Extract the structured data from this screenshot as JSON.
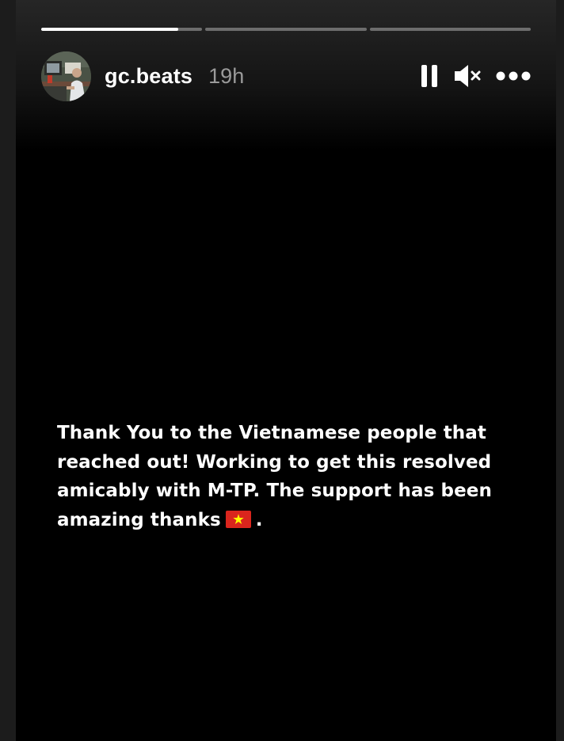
{
  "story": {
    "username": "gc.beats",
    "timestamp": "19h",
    "progress": {
      "segments": [
        {
          "fill": 0.85
        },
        {
          "fill": 0
        },
        {
          "fill": 0
        }
      ]
    },
    "controls": {
      "pause_icon": "pause-icon",
      "mute_icon": "muted-speaker-icon",
      "more_icon": "more-dots-icon"
    },
    "caption": {
      "text": "Thank You to the Vietnamese people that reached out! Working to get this resolved amicably with M-TP. The support has been amazing thanks",
      "flag_icon": "vietnam-flag-icon",
      "trailing": "."
    },
    "colors": {
      "background": "#000000",
      "text": "#ffffff",
      "timestamp": "#9a9a9a",
      "flag_red": "#da251d",
      "flag_star": "#ffff00"
    }
  }
}
